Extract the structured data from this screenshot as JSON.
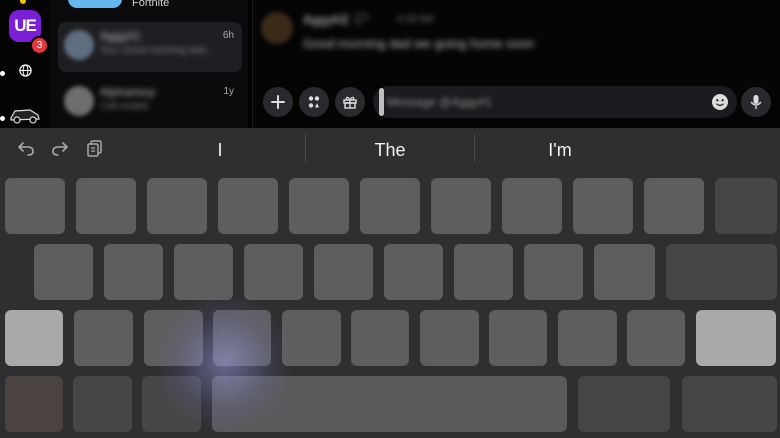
{
  "sidebar": {
    "server_abbrev": "UE",
    "notification_count": "3"
  },
  "dm_list": {
    "top_item_subtitle": "Fortnite",
    "items": [
      {
        "name": "Aggy#1",
        "preview": "You: Good morning dad...",
        "time": "6h"
      },
      {
        "name": "Alpharissy",
        "preview": "Call ended",
        "time": "1y"
      }
    ]
  },
  "chat": {
    "message": {
      "author": "AggyKE 🏳",
      "time": "4:28 AM",
      "text": "Good morning dad we going home soon"
    },
    "input_placeholder": "Message @Aggy#1"
  },
  "keyboard": {
    "suggestions": [
      "I",
      "The",
      "I'm"
    ]
  },
  "colors": {
    "server_accent": "#7a1fd6",
    "badge": "#e0383e",
    "keyboard_bg": "#2f2f31"
  }
}
